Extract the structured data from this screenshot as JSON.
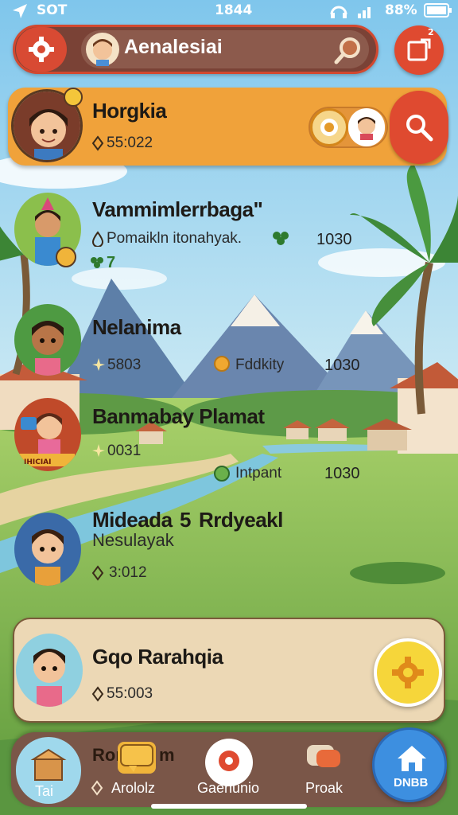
{
  "status_bar": {
    "carrier": "SOT",
    "time": "1844",
    "battery": "88%"
  },
  "header": {
    "title": "Aenalesiai",
    "notification_count": "2"
  },
  "featured": {
    "name": "Horgkia",
    "value": "55:022"
  },
  "rows": [
    {
      "name": "Vammimlerrbaga\"",
      "sub": "Pomaikln itonahyak.",
      "num": "1030",
      "extra": "7"
    },
    {
      "name": "Nelanima",
      "sub": "5803",
      "tag": "Fddkity",
      "num": "1030"
    },
    {
      "name": "Banmabay Plamat",
      "sub": "0031",
      "tag": "Intpant",
      "num": "1030",
      "badge": "IHICIAI"
    },
    {
      "name": "Mideada",
      "name2": "Rrdyeakl",
      "sub_line": "Nesulayak",
      "sub": "3:012",
      "mid": "5"
    }
  ],
  "card": {
    "name": "Gqo Rarahqia",
    "value": "55:003"
  },
  "nav": {
    "item1_label": "Tai",
    "item1_title": "Ror",
    "item1_suffix": "m",
    "item2_label": "Arololz",
    "item3_label": "Gaenunio",
    "item4_label": "Proak",
    "item5_label": "DNBB"
  },
  "colors": {
    "accent": "#d84a33",
    "featured": "#f0a23a",
    "card": "#ecd8b5",
    "nav": "#7a5648",
    "home": "#3d8fe0"
  }
}
